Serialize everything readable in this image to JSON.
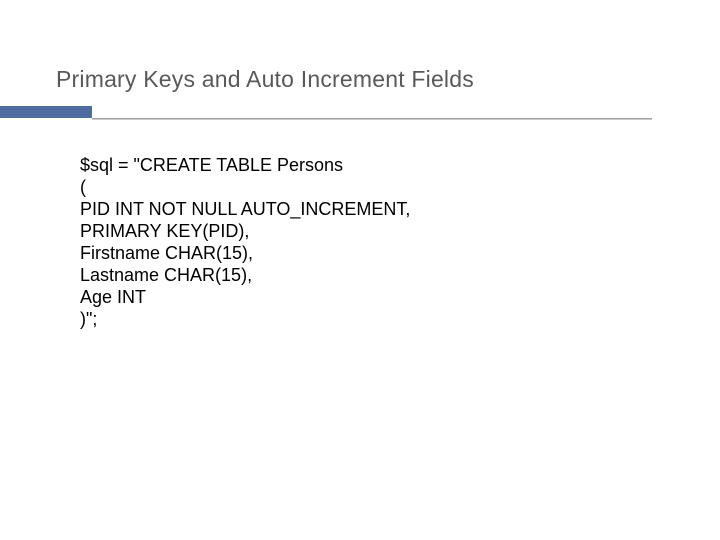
{
  "title": "Primary Keys and Auto Increment Fields",
  "code": {
    "l1": "$sql = \"CREATE TABLE Persons",
    "l2": "(",
    "l3": "PID INT NOT NULL AUTO_INCREMENT,",
    "l4": "PRIMARY KEY(PID),",
    "l5": "Firstname CHAR(15),",
    "l6": "Lastname CHAR(15),",
    "l7": "Age INT",
    "l8": ")\";"
  }
}
